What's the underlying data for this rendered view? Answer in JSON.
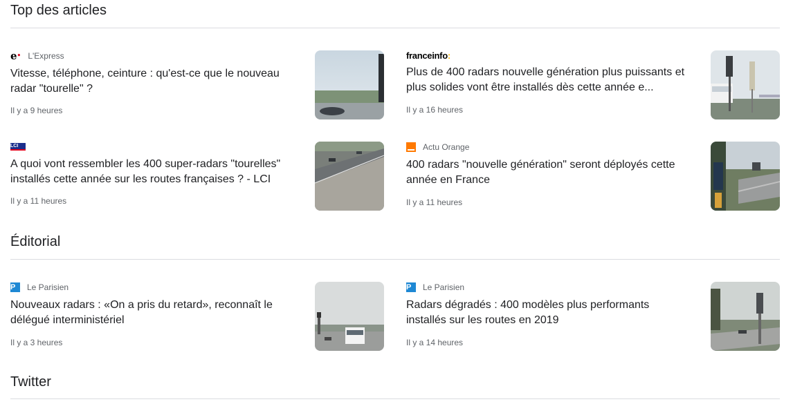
{
  "sections": [
    {
      "title": "Top des articles",
      "articles": [
        {
          "source": "L'Express",
          "logo": "express-logo",
          "headline": "Vitesse, téléphone, ceinture : qu'est-ce que le nouveau radar \"tourelle\" ?",
          "time": "Il y a 9 heures"
        },
        {
          "source": "franceinfo",
          "logo": "franceinfo-logo",
          "headline": "Plus de 400 radars nouvelle génération plus puissants et plus solides vont être installés dès cette année e...",
          "time": "Il y a 16 heures"
        },
        {
          "source": "LCI",
          "logo": "lci-logo",
          "headline": "A quoi vont ressembler les 400 super-radars \"tourelles\" installés cette année sur les routes françaises ? - LCI",
          "time": "Il y a 11 heures"
        },
        {
          "source": "Actu Orange",
          "logo": "orange-logo",
          "headline": "400 radars \"nouvelle génération\" seront déployés cette année en France",
          "time": "Il y a 11 heures"
        }
      ]
    },
    {
      "title": "Éditorial",
      "articles": [
        {
          "source": "Le Parisien",
          "logo": "parisien-logo",
          "headline": "Nouveaux radars : «On a pris du retard», reconnaît le délégué interministériel",
          "time": "Il y a 3 heures"
        },
        {
          "source": "Le Parisien",
          "logo": "parisien-logo",
          "headline": "Radars dégradés : 400 modèles plus performants installés sur les routes en 2019",
          "time": "Il y a 14 heures"
        }
      ]
    },
    {
      "title": "Twitter",
      "articles": []
    }
  ],
  "logos": {
    "lci_text": "LCI",
    "parisien_text": "P"
  }
}
